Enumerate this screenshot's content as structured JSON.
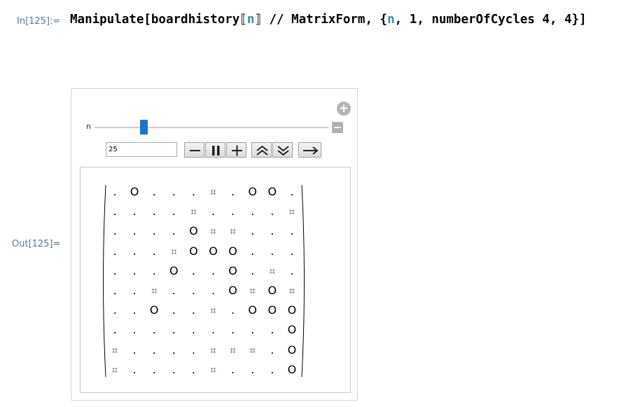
{
  "input_cell": {
    "label": "In[125]:=",
    "code_head": "Manipulate[boardhistory",
    "code_open": "⟦",
    "code_var1": "n",
    "code_close": "⟧",
    "code_mid": " // MatrixForm, {",
    "code_var2": "n",
    "code_tail": ", 1, numberOfCycles 4, 4}]"
  },
  "output_cell": {
    "label": "Out[125]="
  },
  "manipulate": {
    "variable_label": "n",
    "slider": {
      "min": 1,
      "max": 100,
      "value": 25
    },
    "value_text": "25",
    "buttons": [
      {
        "name": "step-back-button",
        "icon": "minus-icon"
      },
      {
        "name": "pause-button",
        "icon": "pause-icon"
      },
      {
        "name": "step-forward-button",
        "icon": "plus-icon"
      },
      {
        "name": "faster-button",
        "icon": "double-chevron-up-icon"
      },
      {
        "name": "slower-button",
        "icon": "double-chevron-down-icon"
      },
      {
        "name": "direction-button",
        "icon": "arrow-right-icon"
      }
    ]
  },
  "matrix": {
    "rows": [
      [
        ".",
        "O",
        ".",
        ".",
        ".",
        "⌗",
        ".",
        "O",
        "O",
        "."
      ],
      [
        ".",
        ".",
        ".",
        ".",
        "⌗",
        ".",
        ".",
        ".",
        ".",
        "⌗"
      ],
      [
        ".",
        ".",
        ".",
        ".",
        "O",
        "⌗",
        "⌗",
        ".",
        ".",
        "."
      ],
      [
        ".",
        ".",
        ".",
        "⌗",
        "O",
        "O",
        "O",
        ".",
        ".",
        "."
      ],
      [
        ".",
        ".",
        ".",
        "O",
        ".",
        ".",
        "O",
        ".",
        "⌗",
        "."
      ],
      [
        ".",
        ".",
        "⌗",
        ".",
        ".",
        ".",
        "O",
        "⌗",
        "O",
        "⌗"
      ],
      [
        ".",
        ".",
        "O",
        ".",
        ".",
        "⌗",
        ".",
        "O",
        "O",
        "O"
      ],
      [
        ".",
        ".",
        ".",
        ".",
        ".",
        ".",
        ".",
        ".",
        ".",
        "O"
      ],
      [
        "⌗",
        ".",
        ".",
        ".",
        ".",
        "⌗",
        "⌗",
        "⌗",
        ".",
        "O"
      ],
      [
        "⌗",
        ".",
        ".",
        ".",
        ".",
        "⌗",
        ".",
        ".",
        ".",
        "O"
      ]
    ]
  }
}
